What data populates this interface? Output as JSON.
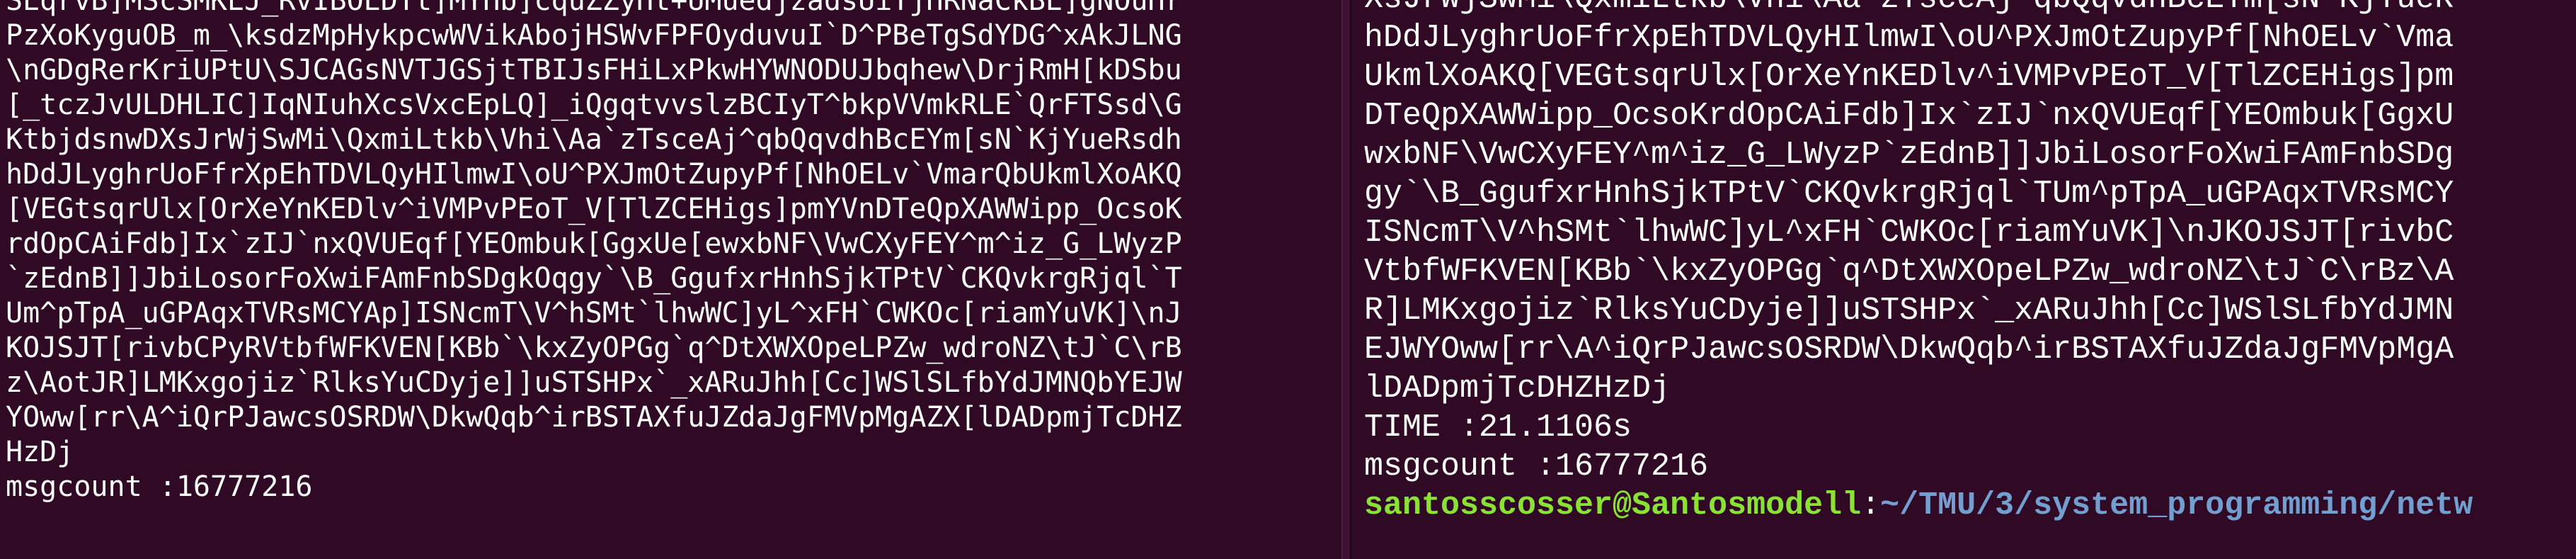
{
  "colors": {
    "background": "#300a24",
    "text": "#ffffff",
    "prompt_user": "#8ae234",
    "prompt_path": "#729fcf"
  },
  "left_terminal": {
    "lines": [
      "SEqrvB]MScSMKEJ_RvIBOEDTt]MYHb]cquZZyHt+UMuedjzadsUiTjHRNaCkBE]gNOuHr",
      "PzXoKyguOB_m_\\ksdzMpHykpcwWVikAbojHSWvFPFOyduvuI`D^PBeTgSdYDG^xAkJLNG",
      "\\nGDgRerKriUPtU\\SJCAGsNVTJGSjtTBIJsFHiLxPkwHYWNODUJbqhew\\DrjRmH[kDSbu",
      "[_tczJvULDHLIC]IqNIuhXcsVxcEpLQ]_iQgqtvvslzBCIyT^bkpVVmkRLE`QrFTSsd\\G",
      "KtbjdsnwDXsJrWjSwMi\\QxmiLtkb\\Vhi\\Aa`zTsceAj^qbQqvdhBcEYm[sN`KjYueRsdh",
      "hDdJLyghrUoFfrXpEhTDVLQyHIlmwI\\oU^PXJmOtZupyPf[NhOELv`VmarQbUkmlXoAKQ",
      "[VEGtsqrUlx[OrXeYnKEDlv^iVMPvPEoT_V[TlZCEHigs]pmYVnDTeQpXAWWipp_OcsoK",
      "rdOpCAiFdb]Ix`zIJ`nxQVUEqf[YEOmbuk[GgxUe[ewxbNF\\VwCXyFEY^m^iz_G_LWyzP",
      "`zEdnB]]JbiLosorFoXwiFAmFnbSDgkOqgy`\\B_GgufxrHnhSjkTPtV`CKQvkrgRjql`T",
      "Um^pTpA_uGPAqxTVRsMCYAp]ISNcmT\\V^hSMt`lhwWC]yL^xFH`CWKOc[riamYuVK]\\nJ",
      "KOJSJT[rivbCPyRVtbfWFKVEN[KBb`\\kxZyOPGg`q^DtXWXOpeLPZw_wdroNZ\\tJ`C\\rB",
      "z\\AotJR]LMKxgojiz`RlksYuCDyje]]uSTSHPx`_xARuJhh[Cc]WSlSLfbYdJMNQbYEJW",
      "YOww[rr\\A^iQrPJawcsOSRDW\\DkwQqb^irBSTAXfuJZdaJgFMVpMgAZX[lDADpmjTcDHZ",
      "HzDj",
      "msgcount :16777216"
    ]
  },
  "right_terminal": {
    "lines": [
      "XsJrWjSwMi\\QxmiLtkb\\Vhi\\Aa`zTsceAj^qbQqvdhBcEYm[sN`KjYueR",
      "hDdJLyghrUoFfrXpEhTDVLQyHIlmwI\\oU^PXJmOtZupyPf[NhOELv`Vma",
      "UkmlXoAKQ[VEGtsqrUlx[OrXeYnKEDlv^iVMPvPEoT_V[TlZCEHigs]pm",
      "DTeQpXAWWipp_OcsoKrdOpCAiFdb]Ix`zIJ`nxQVUEqf[YEOmbuk[GgxU",
      "wxbNF\\VwCXyFEY^m^iz_G_LWyzP`zEdnB]]JbiLosorFoXwiFAmFnbSDg",
      "gy`\\B_GgufxrHnhSjkTPtV`CKQvkrgRjql`TUm^pTpA_uGPAqxTVRsMCY",
      "ISNcmT\\V^hSMt`lhwWC]yL^xFH`CWKOc[riamYuVK]\\nJKOJSJT[rivbC",
      "VtbfWFKVEN[KBb`\\kxZyOPGg`q^DtXWXOpeLPZw_wdroNZ\\tJ`C\\rBz\\A",
      "R]LMKxgojiz`RlksYuCDyje]]uSTSHPx`_xARuJhh[Cc]WSlSLfbYdJMN",
      "EJWYOww[rr\\A^iQrPJawcsOSRDW\\DkwQqb^irBSTAXfuJZdaJgFMVpMgA",
      "lDADpmjTcDHZHzDj",
      "TIME :21.1106s",
      "msgcount :16777216"
    ],
    "prompt": {
      "user": "santosscosser@Santosmodell",
      "separator": ":",
      "path": "~/TMU/3/system_programming/netw"
    }
  }
}
